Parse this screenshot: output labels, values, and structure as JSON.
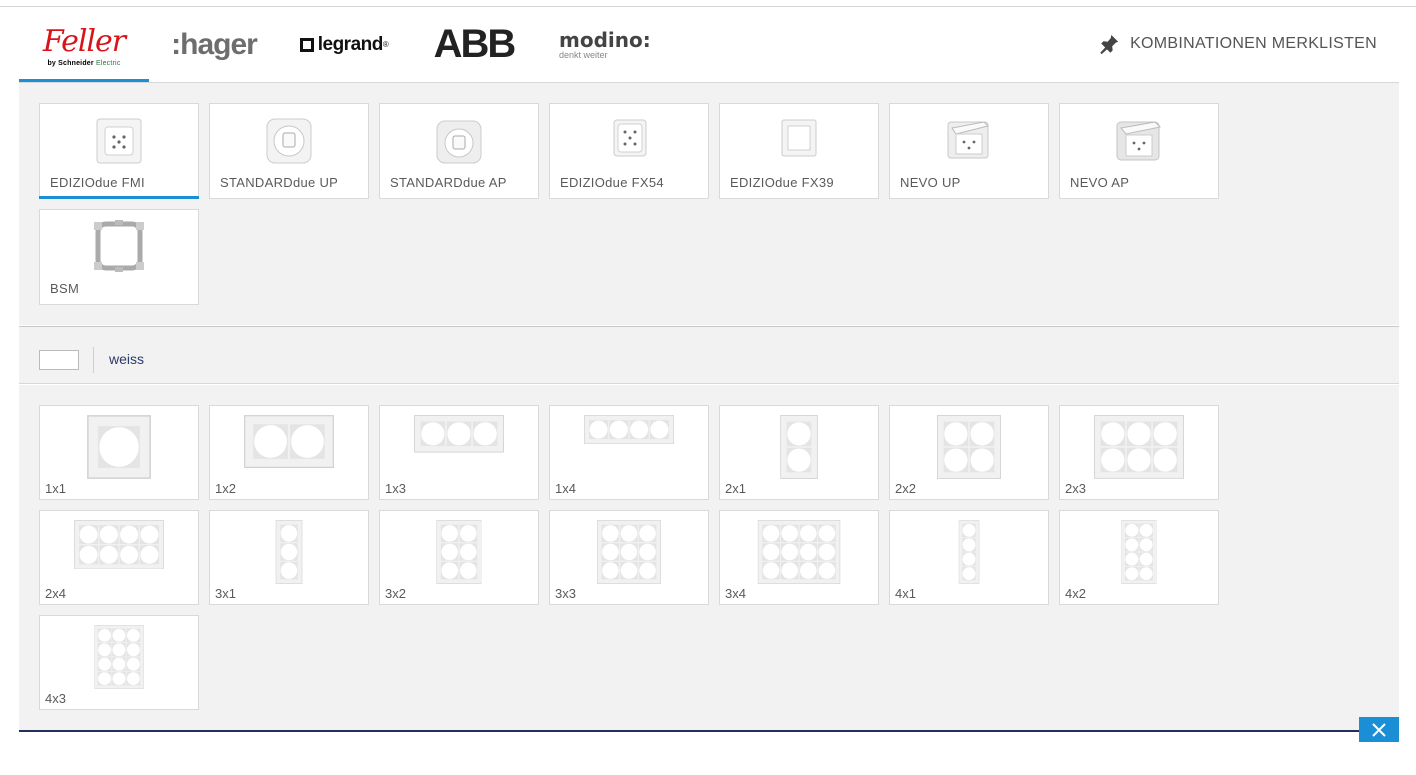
{
  "brands": [
    {
      "name": "Feller",
      "sub_bold": "by Schneider",
      "sub_light": "Electric",
      "active": true
    },
    {
      "name": ":hager"
    },
    {
      "name": "legrand",
      "mark": "®"
    },
    {
      "name": "ABB"
    },
    {
      "name": "modino",
      "suffix": ":",
      "sub": "denkt weiter"
    }
  ],
  "header": {
    "kombinationen_label": "KOMBINATIONEN MERKLISTEN"
  },
  "products": [
    {
      "label": "EDIZIOdue FMI",
      "selected": true,
      "icon": "socket-flush-icon"
    },
    {
      "label": "STANDARDdue UP",
      "icon": "round-switch-icon"
    },
    {
      "label": "STANDARDdue AP",
      "icon": "round-switch-surface-icon"
    },
    {
      "label": "EDIZIOdue FX54",
      "icon": "socket-flush-icon"
    },
    {
      "label": "EDIZIOdue FX39",
      "icon": "square-switch-icon"
    },
    {
      "label": "NEVO UP",
      "icon": "ip-socket-icon"
    },
    {
      "label": "NEVO AP",
      "icon": "ip-socket-surface-icon"
    },
    {
      "label": "BSM",
      "icon": "mounting-frame-icon"
    }
  ],
  "color": {
    "label": "weiss",
    "swatch": "#ffffff"
  },
  "frames": [
    {
      "label": "1x1",
      "rows": 1,
      "cols": 1
    },
    {
      "label": "1x2",
      "rows": 1,
      "cols": 2
    },
    {
      "label": "1x3",
      "rows": 1,
      "cols": 3
    },
    {
      "label": "1x4",
      "rows": 1,
      "cols": 4
    },
    {
      "label": "2x1",
      "rows": 2,
      "cols": 1
    },
    {
      "label": "2x2",
      "rows": 2,
      "cols": 2
    },
    {
      "label": "2x3",
      "rows": 2,
      "cols": 3
    },
    {
      "label": "2x4",
      "rows": 2,
      "cols": 4
    },
    {
      "label": "3x1",
      "rows": 3,
      "cols": 1
    },
    {
      "label": "3x2",
      "rows": 3,
      "cols": 2
    },
    {
      "label": "3x3",
      "rows": 3,
      "cols": 3
    },
    {
      "label": "3x4",
      "rows": 3,
      "cols": 4
    },
    {
      "label": "4x1",
      "rows": 4,
      "cols": 1
    },
    {
      "label": "4x2",
      "rows": 4,
      "cols": 2
    },
    {
      "label": "4x3",
      "rows": 4,
      "cols": 3
    }
  ],
  "colors": {
    "accent": "#1a8fd6",
    "navy": "#23305e",
    "feller_red": "#d8141a"
  }
}
